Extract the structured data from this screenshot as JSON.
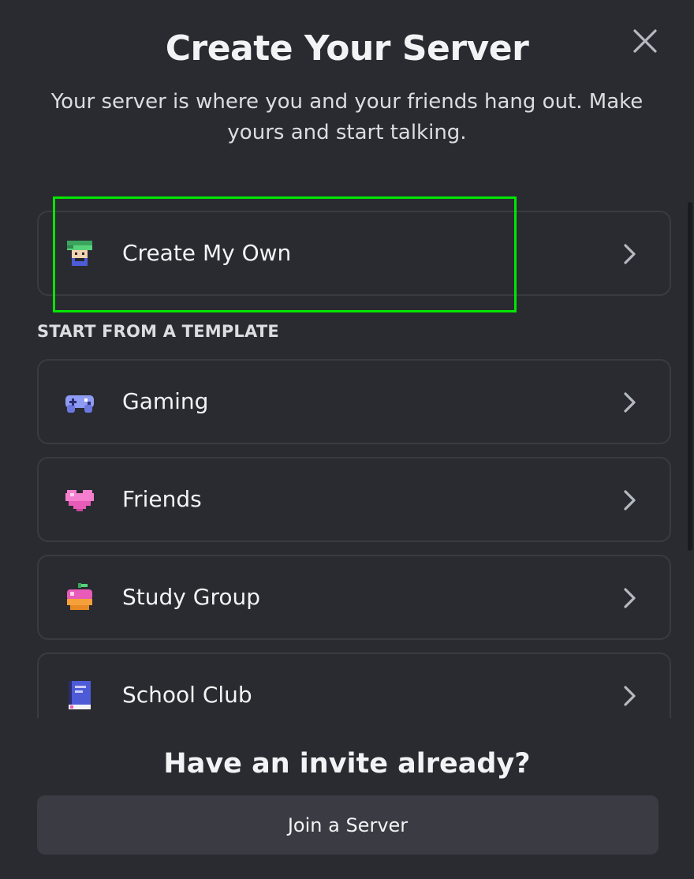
{
  "modal": {
    "title": "Create Your Server",
    "subtitle": "Your server is where you and your friends hang out. Make yours and start talking.",
    "close_icon": "close-icon"
  },
  "create_own": {
    "label": "Create My Own",
    "icon": "pixel-avatar-icon"
  },
  "templates": {
    "header": "START FROM A TEMPLATE",
    "items": [
      {
        "label": "Gaming",
        "icon": "gamepad-icon"
      },
      {
        "label": "Friends",
        "icon": "heart-icon"
      },
      {
        "label": "Study Group",
        "icon": "apple-icon"
      },
      {
        "label": "School Club",
        "icon": "book-icon"
      }
    ]
  },
  "invite": {
    "title": "Have an invite already?",
    "button_label": "Join a Server"
  },
  "colors": {
    "background": "#2a2b31",
    "card_border": "#3a3b41",
    "button_bg": "#3b3c43",
    "highlight": "#00e600",
    "text_primary": "#f2f3f5"
  }
}
